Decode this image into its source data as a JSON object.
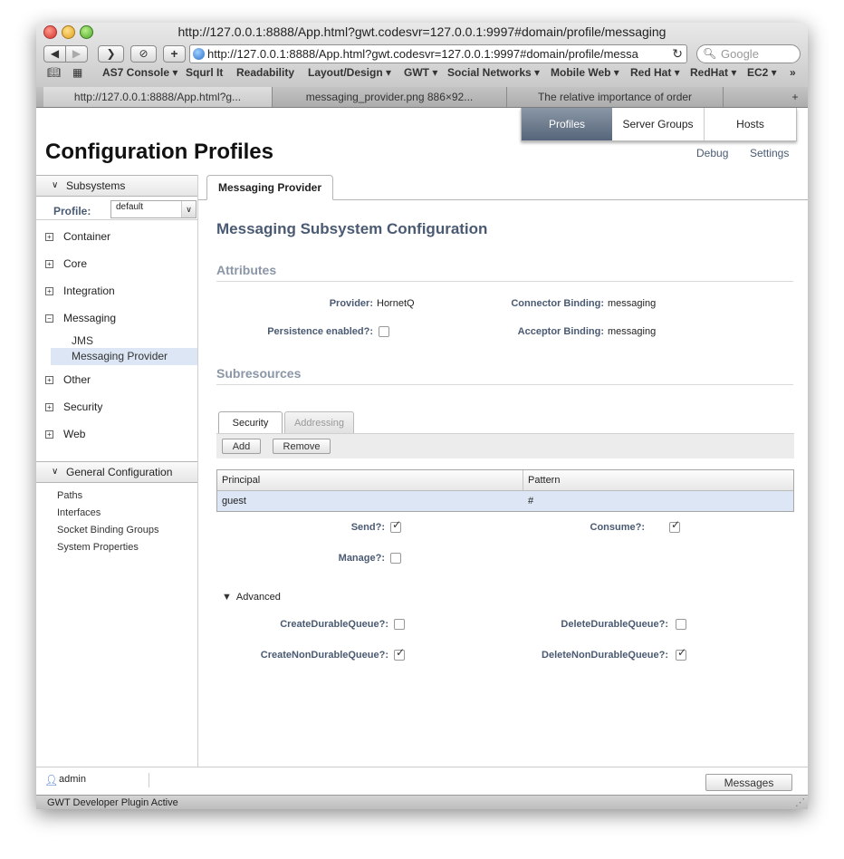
{
  "browser": {
    "title": "http://127.0.0.1:8888/App.html?gwt.codesvr=127.0.0.1:9997#domain/profile/messaging",
    "url": "http://127.0.0.1:8888/App.html?gwt.codesvr=127.0.0.1:9997#domain/profile/messa",
    "search_placeholder": "Google",
    "bookmarks": [
      "AS7 Console ▾",
      "Squrl It",
      "Readability",
      "Layout/Design ▾",
      "GWT ▾",
      "Social Networks ▾",
      "Mobile Web ▾",
      "Red Hat ▾",
      "RedHat ▾",
      "EC2 ▾",
      "»"
    ],
    "tabs": [
      "http://127.0.0.1:8888/App.html?g...",
      "messaging_provider.png 886×92...",
      "The relative importance of order"
    ],
    "new_tab": "+"
  },
  "topnav": {
    "items": [
      "Profiles",
      "Server Groups",
      "Hosts"
    ],
    "active": "Profiles"
  },
  "header": {
    "title": "Configuration Profiles",
    "links": [
      "Debug",
      "Settings"
    ]
  },
  "sidebar": {
    "subsystems_label": "Subsystems",
    "profile_label": "Profile:",
    "profile_value": "default",
    "items": [
      {
        "label": "Container",
        "icon": "⊞"
      },
      {
        "label": "Core",
        "icon": "⊞"
      },
      {
        "label": "Integration",
        "icon": "⊞"
      },
      {
        "label": "Messaging",
        "icon": "⊟"
      },
      {
        "label": "Other",
        "icon": "⊞"
      },
      {
        "label": "Security",
        "icon": "⊞"
      },
      {
        "label": "Web",
        "icon": "⊞"
      }
    ],
    "messaging_children": [
      "JMS",
      "Messaging Provider"
    ],
    "general_label": "General Configuration",
    "general_items": [
      "Paths",
      "Interfaces",
      "Socket Binding Groups",
      "System Properties"
    ]
  },
  "main": {
    "tab": "Messaging Provider",
    "heading": "Messaging Subsystem Configuration",
    "attributes_label": "Attributes",
    "provider_label": "Provider:",
    "provider_value": "HornetQ",
    "connector_label": "Connector Binding:",
    "connector_value": "messaging",
    "persistence_label": "Persistence enabled?:",
    "acceptor_label": "Acceptor Binding:",
    "acceptor_value": "messaging",
    "subresources_label": "Subresources",
    "subtabs": [
      "Security",
      "Addressing"
    ],
    "add_label": "Add",
    "remove_label": "Remove",
    "table": {
      "columns": [
        "Principal",
        "Pattern"
      ],
      "rows": [
        [
          "guest",
          "#"
        ]
      ]
    },
    "send_label": "Send?:",
    "consume_label": "Consume?:",
    "manage_label": "Manage?:",
    "advanced_label": "Advanced",
    "create_durable_label": "CreateDurableQueue?:",
    "delete_durable_label": "DeleteDurableQueue?:",
    "create_nondurable_label": "CreateNonDurableQueue?:",
    "delete_nondurable_label": "DeleteNonDurableQueue?:",
    "checks": {
      "persistence": false,
      "send": true,
      "consume": true,
      "manage": false,
      "create_durable": false,
      "delete_durable": false,
      "create_nondurable": true,
      "delete_nondurable": true
    }
  },
  "footer": {
    "user": "admin",
    "messages_label": "Messages"
  },
  "statusbar": {
    "text": "GWT Developer Plugin Active"
  }
}
